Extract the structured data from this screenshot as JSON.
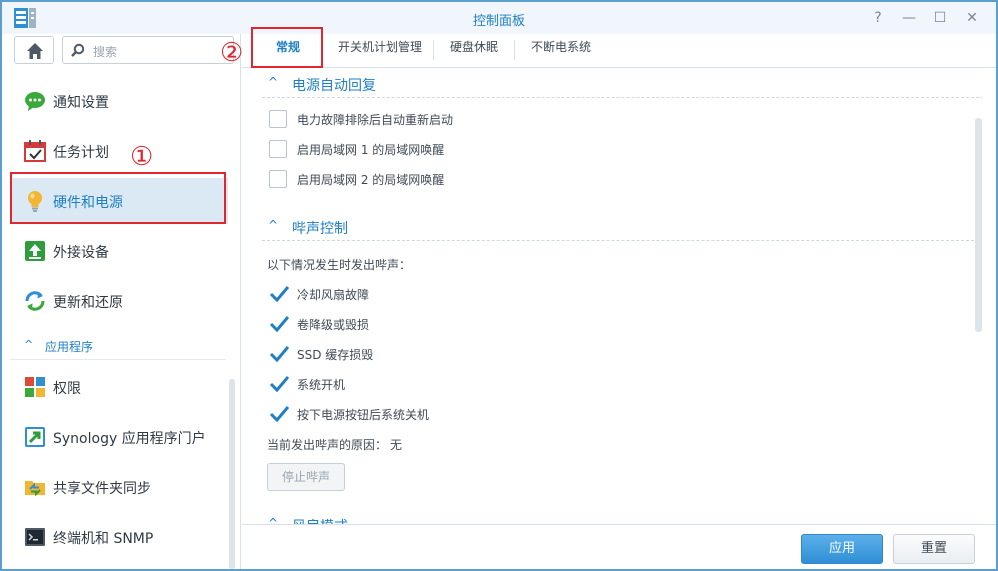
{
  "window": {
    "title": "控制面板",
    "controls": [
      "?",
      "—",
      "☐",
      "✕"
    ],
    "accent_color": "#1f7fc4",
    "border_color": "#5a9fd0"
  },
  "sidebar": {
    "search_placeholder": "搜索",
    "items": [
      {
        "label": "通知设置",
        "icon": "notification-icon"
      },
      {
        "label": "任务计划",
        "icon": "calendar-icon"
      },
      {
        "label": "硬件和电源",
        "icon": "lightbulb-icon",
        "active": true
      },
      {
        "label": "外接设备",
        "icon": "external-device-icon"
      },
      {
        "label": "更新和还原",
        "icon": "update-icon"
      }
    ],
    "section": {
      "label": "应用程序",
      "chevron": "^"
    },
    "app_items": [
      {
        "label": "权限",
        "icon": "privileges-icon"
      },
      {
        "label": "Synology 应用程序门户",
        "icon": "portal-icon"
      },
      {
        "label": "共享文件夹同步",
        "icon": "folder-sync-icon"
      },
      {
        "label": "终端机和 SNMP",
        "icon": "terminal-icon"
      }
    ]
  },
  "tabs": [
    "常规",
    "开关机计划管理",
    "硬盘休眠",
    "不断电系统"
  ],
  "content": {
    "power_recovery": {
      "title": "电源自动回复",
      "options": [
        {
          "label": "电力故障排除后自动重新启动",
          "checked": false
        },
        {
          "label": "启用局域网 1 的局域网唤醒",
          "checked": false
        },
        {
          "label": "启用局域网 2 的局域网唤醒",
          "checked": false
        }
      ]
    },
    "beep_control": {
      "title": "哔声控制",
      "intro": "以下情况发生时发出哔声：",
      "options": [
        {
          "label": "冷却风扇故障",
          "checked": true
        },
        {
          "label": "卷降级或毁损",
          "checked": true
        },
        {
          "label": "SSD 缓存损毁",
          "checked": true
        },
        {
          "label": "系统开机",
          "checked": true
        },
        {
          "label": "按下电源按钮后系统关机",
          "checked": true
        }
      ],
      "current_reason_label": "当前发出哔声的原因：",
      "current_reason_value": "无",
      "stop_button": "停止哔声"
    },
    "fan_mode_partial": "风扇模式"
  },
  "footer": {
    "apply": "应用",
    "reset": "重置"
  },
  "annotations": {
    "marker1": "①",
    "marker2": "②",
    "color": "#e0262f"
  }
}
